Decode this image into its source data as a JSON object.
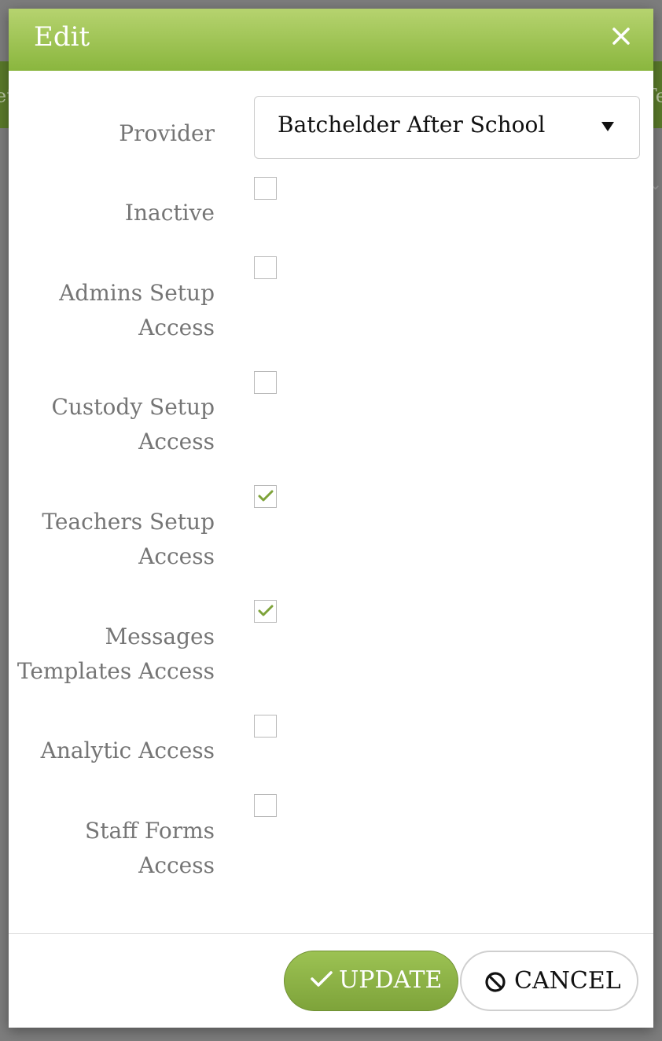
{
  "background": {
    "left_fragment": "et",
    "right_fragment": "Te",
    "chevron": "⌄"
  },
  "dialog": {
    "title": "Edit",
    "close_icon": "close-icon"
  },
  "form": {
    "provider": {
      "label": "Provider",
      "value": "Batchelder After School"
    },
    "fields": [
      {
        "label": "Inactive",
        "checked": false
      },
      {
        "label": "Admins Setup Access",
        "checked": false
      },
      {
        "label": "Custody Setup Access",
        "checked": false
      },
      {
        "label": "Teachers Setup Access",
        "checked": true
      },
      {
        "label": "Messages Templates Access",
        "checked": true
      },
      {
        "label": "Analytic Access",
        "checked": false
      },
      {
        "label": "Staff Forms Access",
        "checked": false
      }
    ]
  },
  "footer": {
    "update_label": "UPDATE",
    "cancel_label": "CANCEL"
  },
  "colors": {
    "accent": "#8ab63e",
    "check": "#7ea33a"
  }
}
